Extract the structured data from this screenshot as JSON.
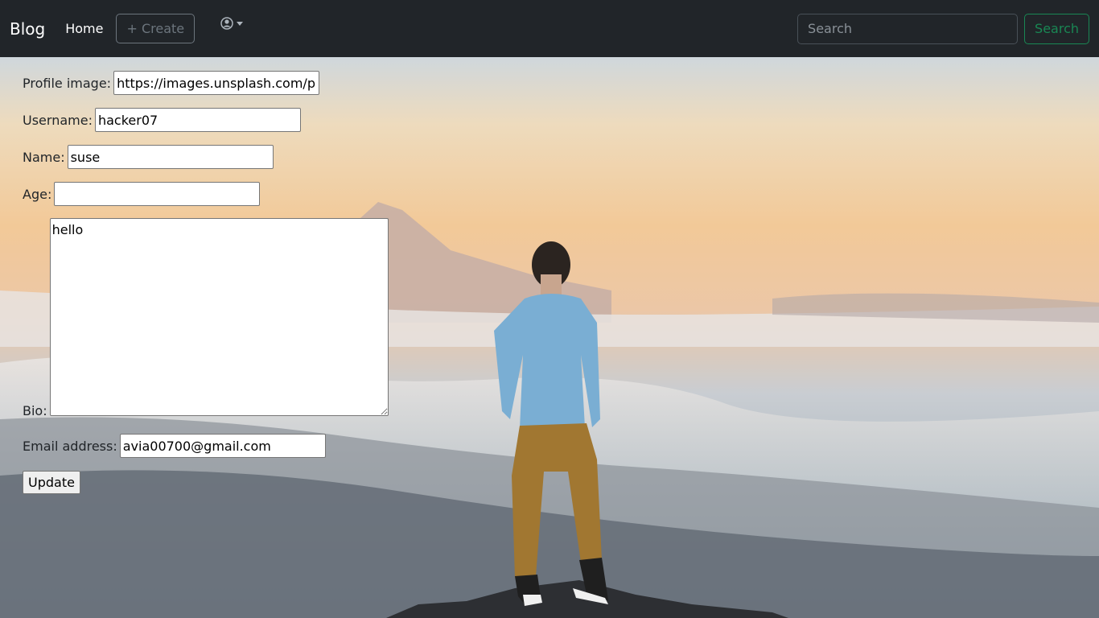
{
  "navbar": {
    "brand": "Blog",
    "home_link": "Home",
    "create_button": "+ Create",
    "user_icon": "user-circle-icon",
    "search_placeholder": "Search",
    "search_button": "Search",
    "colors": {
      "background": "#212529",
      "create_outline": "#6c757d",
      "search_accent": "#198754"
    }
  },
  "form": {
    "profile_image": {
      "label": "Profile image:",
      "value": "https://images.unsplash.com/phot"
    },
    "username": {
      "label": "Username:",
      "value": "hacker07"
    },
    "name": {
      "label": "Name:",
      "value": "suse"
    },
    "age": {
      "label": "Age:",
      "value": ""
    },
    "bio": {
      "label": "Bio:",
      "value": "hello"
    },
    "email": {
      "label": "Email address:",
      "value": "avia00700@gmail.com"
    },
    "update_button": "Update"
  },
  "background": {
    "description_icon": "mountain-landscape-photo"
  }
}
